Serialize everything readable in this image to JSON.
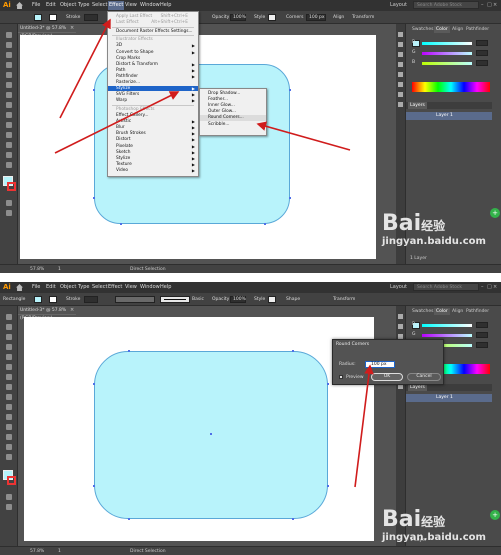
{
  "app": {
    "logo": "Ai",
    "layout": "Layout",
    "search_placeholder": "Search Adobe Stock"
  },
  "menu": [
    "File",
    "Edit",
    "Object",
    "Type",
    "Select",
    "Effect",
    "View",
    "Window",
    "Help"
  ],
  "control_bar": {
    "shot1": {
      "stroke_label": "Stroke",
      "opacity_label": "Opacity",
      "opacity_value": "100%",
      "style_label": "Style",
      "corners_label": "Corners",
      "corners_value": "100 px",
      "align_label": "Align",
      "transform_label": "Transform"
    },
    "shot2": {
      "tool_name": "Rectangle",
      "stroke_label": "Stroke",
      "basic_label": "Basic",
      "opacity_label": "Opacity",
      "opacity_value": "100%",
      "style_label": "Style",
      "shape_label": "Shape",
      "transform_label": "Transform"
    }
  },
  "document_tab": "Untitled-3* @ 57.8% (RGB/Preview)",
  "status": {
    "zoom": "57.8%",
    "page": "1",
    "tool": "Direct Selection",
    "layers": "1 Layer"
  },
  "effect_menu": {
    "items": [
      {
        "label": "Apply Last Effect",
        "shortcut": "Shift+Ctrl+E",
        "disabled": true
      },
      {
        "label": "Last Effect",
        "shortcut": "Alt+Shift+Ctrl+E",
        "disabled": true
      },
      {
        "label": "Document Raster Effects Settings..."
      },
      {
        "label": "Illustrator Effects",
        "header": true
      },
      {
        "label": "3D",
        "arrow": true
      },
      {
        "label": "Convert to Shape",
        "arrow": true
      },
      {
        "label": "Crop Marks"
      },
      {
        "label": "Distort & Transform",
        "arrow": true
      },
      {
        "label": "Path",
        "arrow": true
      },
      {
        "label": "Pathfinder",
        "arrow": true
      },
      {
        "label": "Rasterize..."
      },
      {
        "label": "Stylize",
        "arrow": true,
        "highlight": true
      },
      {
        "label": "SVG Filters",
        "arrow": true
      },
      {
        "label": "Warp",
        "arrow": true
      },
      {
        "label": "Photoshop Effects",
        "header": true
      },
      {
        "label": "Effect Gallery..."
      },
      {
        "label": "Artistic",
        "arrow": true
      },
      {
        "label": "Blur",
        "arrow": true
      },
      {
        "label": "Brush Strokes",
        "arrow": true
      },
      {
        "label": "Distort",
        "arrow": true
      },
      {
        "label": "Pixelate",
        "arrow": true
      },
      {
        "label": "Sketch",
        "arrow": true
      },
      {
        "label": "Stylize",
        "arrow": true
      },
      {
        "label": "Texture",
        "arrow": true
      },
      {
        "label": "Video",
        "arrow": true
      }
    ]
  },
  "stylize_submenu": {
    "items": [
      {
        "label": "Drop Shadow..."
      },
      {
        "label": "Feather..."
      },
      {
        "label": "Inner Glow..."
      },
      {
        "label": "Outer Glow..."
      },
      {
        "label": "Round Corners..."
      },
      {
        "label": "Scribble..."
      }
    ]
  },
  "panels": {
    "tabs": [
      "Swatches",
      "Color",
      "Align",
      "Pathfinder"
    ],
    "layers_tab": "Layers",
    "layer_name": "Layer 1"
  },
  "dialog": {
    "title": "Round Corners",
    "radius_label": "Radius:",
    "radius_value": "100 px",
    "preview_label": "Preview",
    "ok_label": "OK",
    "cancel_label": "Cancel"
  },
  "colors": {
    "fill": "#b8f3fb",
    "accent_arrow": "#d01c1c",
    "menu_highlight": "#1e64c8"
  },
  "watermark": {
    "brand": "Bai",
    "brand_cn": "经验",
    "url": "jingyan.baidu.com"
  }
}
